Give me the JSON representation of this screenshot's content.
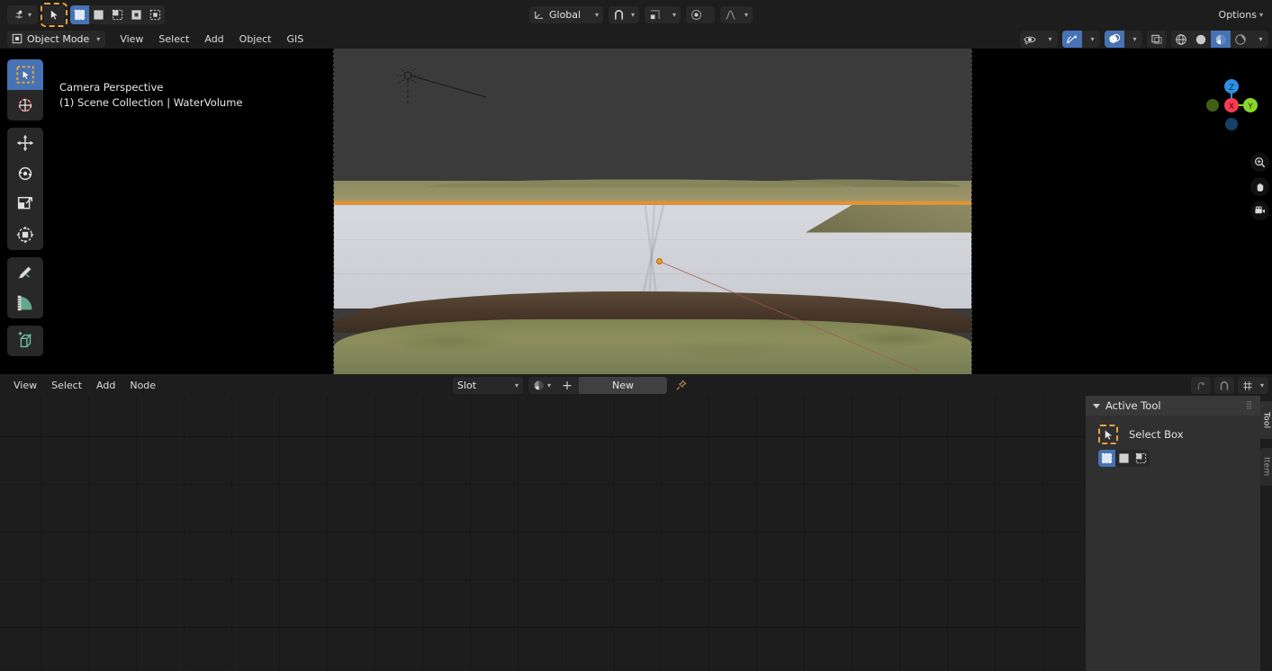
{
  "topbar": {
    "editor_type_icon": "editor-type-icon",
    "cursor_tool_icon": "select-box-cursor-icon",
    "select_modes": [
      {
        "name": "set",
        "label": "Set",
        "active": true
      },
      {
        "name": "extend",
        "label": "Extend",
        "active": false
      },
      {
        "name": "subtract",
        "label": "Subtract",
        "active": false
      },
      {
        "name": "invert",
        "label": "Invert",
        "active": false
      },
      {
        "name": "intersect",
        "label": "Intersect",
        "active": false
      }
    ],
    "transform_orientation": "Global",
    "snap_icon": "magnet-icon",
    "snap_target_icon": "snap-increment-icon",
    "proportional_icon": "proportional-editing-icon",
    "falloff_icon": "smooth-falloff-icon",
    "options_label": "Options"
  },
  "viewport": {
    "mode": "Object Mode",
    "menus": [
      "View",
      "Select",
      "Add",
      "Object",
      "GIS"
    ],
    "overlay_text_line1": "Camera Perspective",
    "overlay_text_line2": "(1) Scene Collection | WaterVolume",
    "right_controls": {
      "visibility_icon": "object-visibility-icon",
      "gizmo_icon": "gizmo-icon",
      "overlays_icon": "overlays-icon",
      "xray_icon": "xray-toggle-icon",
      "shading": [
        {
          "name": "wireframe",
          "active": false
        },
        {
          "name": "solid",
          "active": false
        },
        {
          "name": "material-preview",
          "active": true
        },
        {
          "name": "rendered",
          "active": false
        }
      ]
    },
    "axis_gizmo": {
      "x": "X",
      "y": "Y",
      "z": "Z",
      "x_color": "#fa3b52",
      "y_color": "#8ad72b",
      "z_color": "#2f8ee5"
    },
    "nav_icons": [
      "zoom-icon",
      "pan-icon",
      "camera-view-icon"
    ],
    "selected_object_outline_color": "#e8932c",
    "origin_color": "#ef9d28"
  },
  "shader_editor": {
    "menus": [
      "View",
      "Select",
      "Add",
      "Node"
    ],
    "slot_label": "Slot",
    "material_browse_icon": "material-browse-icon",
    "add_new_icon": "plus-icon",
    "new_label": "New",
    "pin_icon": "pin-icon",
    "parent_icon": "go-to-parent-icon",
    "snap_icon": "magnet-icon",
    "snap_dropdown_icon": "snap-node-icon"
  },
  "side_panel": {
    "tabs": [
      {
        "label": "Tool",
        "active": true
      },
      {
        "label": "Item",
        "active": false
      }
    ],
    "panel_title": "Active Tool",
    "active_tool_name": "Select Box",
    "tool_icon": "select-box-icon",
    "select_modes": [
      {
        "name": "set",
        "active": true
      },
      {
        "name": "extend",
        "active": false
      },
      {
        "name": "subtract",
        "active": false
      }
    ]
  },
  "colors": {
    "accent_blue": "#4772b3",
    "accent_orange": "#e8a33d",
    "panel_bg": "#303030",
    "editor_bg": "#1d1d1d",
    "widget_bg": "#282828"
  }
}
